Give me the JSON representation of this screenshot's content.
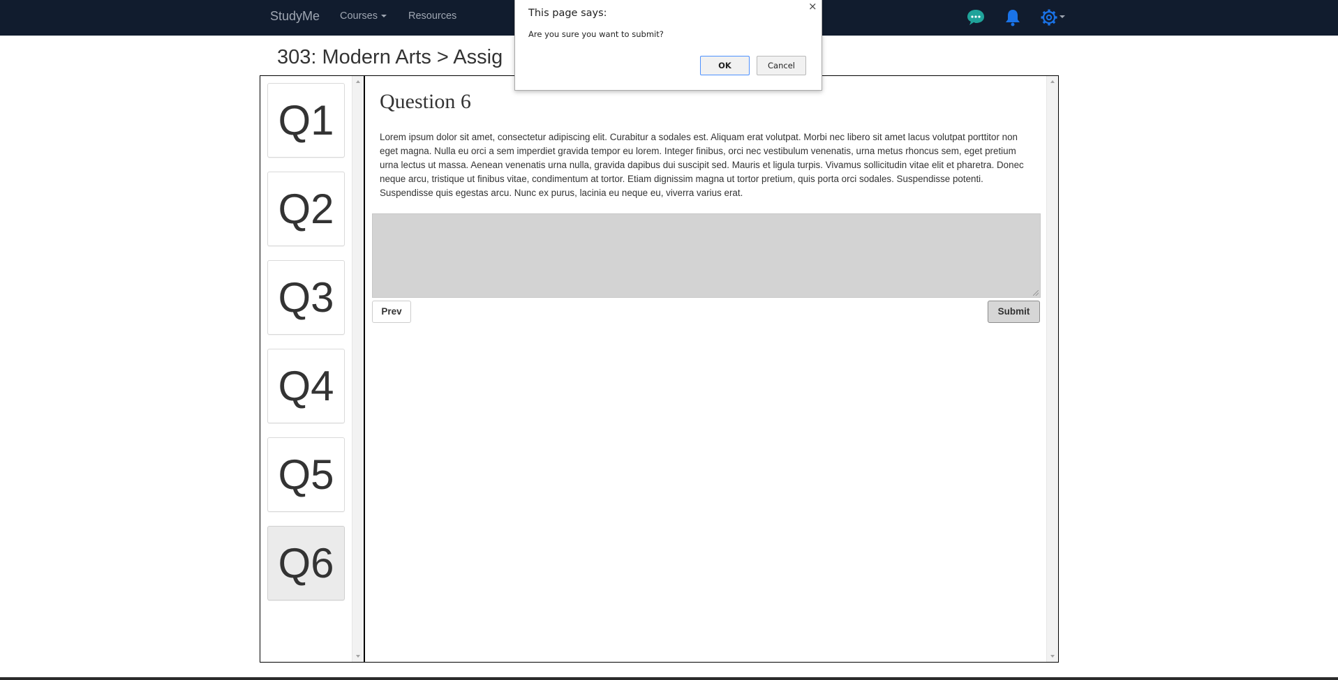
{
  "navbar": {
    "brand": "StudyMe",
    "courses_label": "Courses",
    "resources_label": "Resources",
    "icons": [
      "chat-icon",
      "bell-icon",
      "gear-icon"
    ],
    "colors": {
      "background": "#111c2e",
      "chat": "#1fa39a",
      "bell": "#1a73e8",
      "gear": "#1a73e8"
    }
  },
  "page": {
    "title": "303: Modern Arts > Assig"
  },
  "questions_nav": {
    "items": [
      {
        "label": "Q1",
        "active": false
      },
      {
        "label": "Q2",
        "active": false
      },
      {
        "label": "Q3",
        "active": false
      },
      {
        "label": "Q4",
        "active": false
      },
      {
        "label": "Q5",
        "active": false
      },
      {
        "label": "Q6",
        "active": true
      }
    ]
  },
  "question": {
    "heading": "Question 6",
    "text": "Lorem ipsum dolor sit amet, consectetur adipiscing elit. Curabitur a sodales est. Aliquam erat volutpat. Morbi nec libero sit amet lacus volutpat porttitor non eget magna. Nulla eu orci a sem imperdiet gravida tempor eu lorem. Integer finibus, orci nec vestibulum venenatis, urna metus rhoncus sem, eget pretium urna lectus ut massa. Aenean venenatis urna nulla, gravida dapibus dui suscipit sed. Mauris et ligula turpis. Vivamus sollicitudin vitae elit et pharetra. Donec neque arcu, tristique ut finibus vitae, condimentum at tortor. Etiam dignissim magna ut tortor pretium, quis porta orci sodales. Suspendisse potenti. Suspendisse quis egestas arcu. Nunc ex purus, lacinia eu neque eu, viverra varius erat.",
    "answer_value": "",
    "prev_label": "Prev",
    "submit_label": "Submit"
  },
  "dialog": {
    "title": "This page says:",
    "close_glyph": "×",
    "message": "Are you sure you want to submit?",
    "ok_label": "OK",
    "cancel_label": "Cancel"
  }
}
